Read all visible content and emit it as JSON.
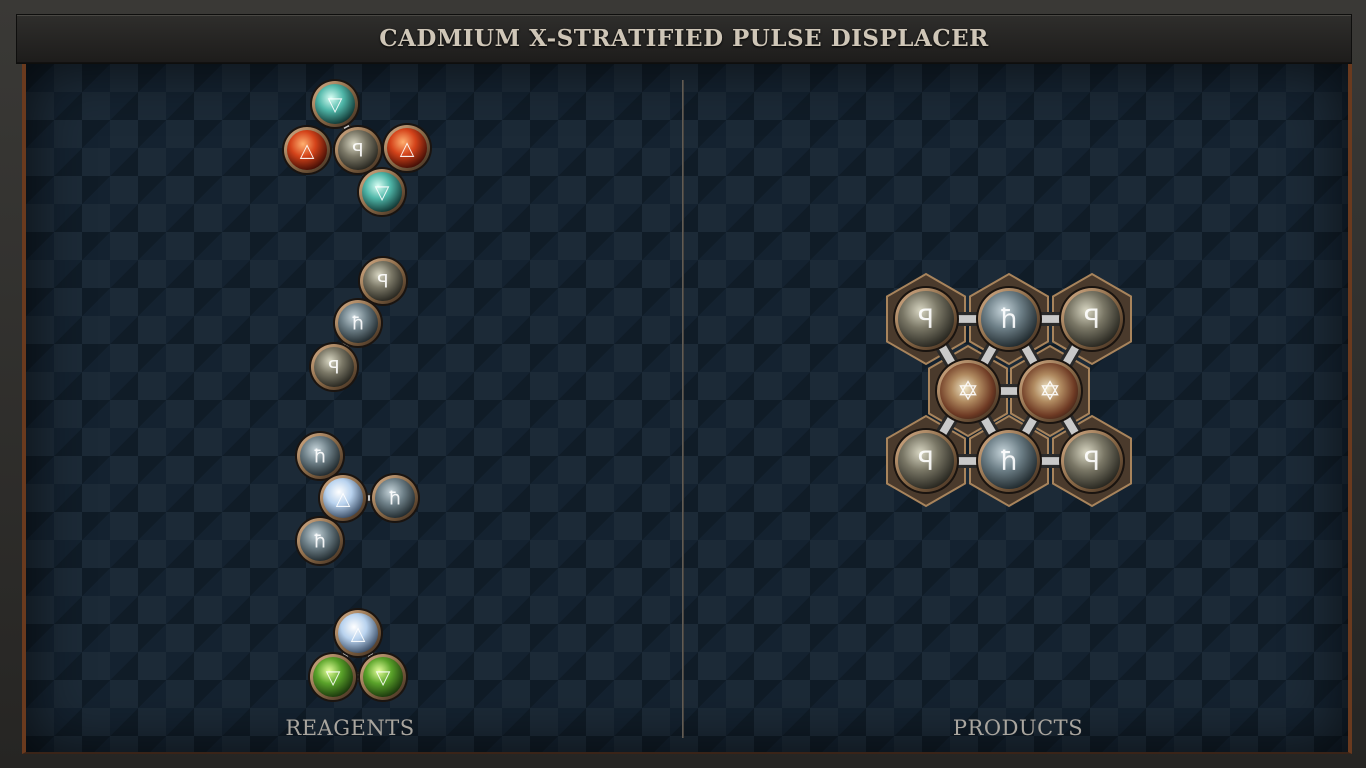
{
  "window": {
    "title": "CADMIUM X-STRATIFIED PULSE DISPLACER"
  },
  "sections": {
    "left_label": "REAGENTS",
    "right_label": "PRODUCTS"
  },
  "colors": {
    "fire": "#d4431a",
    "water": "#4fb6a8",
    "earth": "#5aa32a",
    "air": "#b8d2ee",
    "salt": "#7a7766",
    "lead": "#6e8088",
    "quintessence": "#b08a60",
    "bond": "#c9c9c9",
    "rim": "#8a6a48"
  },
  "glyphs": {
    "fire": "△",
    "water": "▽",
    "earth": "▽",
    "air": "△",
    "salt": "ꟼ",
    "lead": "ħ",
    "quintessence": "✡"
  },
  "molecules": {
    "reagents": [
      {
        "name": "reagent-1",
        "atoms": [
          "water",
          "fire",
          "salt",
          "fire",
          "water"
        ]
      },
      {
        "name": "reagent-2",
        "atoms": [
          "salt",
          "lead",
          "salt"
        ]
      },
      {
        "name": "reagent-3",
        "atoms": [
          "lead",
          "air",
          "lead",
          "lead"
        ]
      },
      {
        "name": "reagent-4",
        "atoms": [
          "air",
          "earth",
          "earth"
        ]
      }
    ],
    "products": [
      {
        "name": "product-1",
        "atoms": [
          "salt",
          "lead",
          "salt",
          "quintessence",
          "quintessence",
          "salt",
          "lead",
          "salt"
        ]
      }
    ]
  }
}
